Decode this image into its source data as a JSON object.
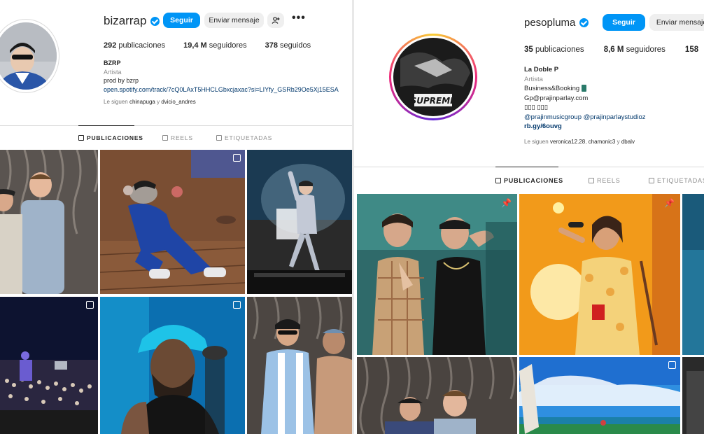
{
  "profiles": {
    "left": {
      "username": "bizarrap",
      "follow_label": "Seguir",
      "message_label": "Enviar mensaje",
      "more_label": "•••",
      "stats": {
        "posts": "292",
        "posts_label": "publicaciones",
        "followers": "19,4 M",
        "followers_label": "seguidores",
        "following": "378",
        "following_label": "seguidos"
      },
      "bio": {
        "name": "BZRP",
        "category": "Artista",
        "line1": "prod by bzrp",
        "link": "open.spotify.com/track/7cQ0LAxT5HHCLGbxcjaxac?si=LIYfy_GSRb29Oe5Xj15ESA"
      },
      "followed_by": {
        "prefix": "Le siguen",
        "user1": "chinapuga",
        "joiner": "y",
        "user2": "dvicio_andres"
      },
      "tabs": [
        "PUBLICACIONES",
        "REELS",
        "ETIQUETADAS"
      ],
      "accent": "#0095f6"
    },
    "right": {
      "username": "pesopluma",
      "follow_label": "Seguir",
      "message_label": "Enviar mensaje",
      "stats": {
        "posts": "35",
        "posts_label": "publicaciones",
        "followers": "8,6 M",
        "followers_label": "seguidores",
        "following": "158"
      },
      "bio": {
        "name": "La Doble P",
        "category": "Artista",
        "line1": "Business&Booking",
        "line2": "Gp@prajinparlay.com",
        "line3": "▯▯▯ ▯▯▯",
        "line4": "@prajinmusicgroup @prajinparlaystudioz",
        "link": "rb.gy/6ouvg"
      },
      "avatar_text": "SUPREME",
      "followed_by": {
        "prefix": "Le siguen",
        "user1": "veronica12.28",
        "joiner": ",",
        "user2": "chamonic3",
        "joiner2": "y",
        "user3": "dbalv"
      },
      "tabs": [
        "PUBLICACIONES",
        "REELS",
        "ETIQUETADAS"
      ]
    }
  }
}
